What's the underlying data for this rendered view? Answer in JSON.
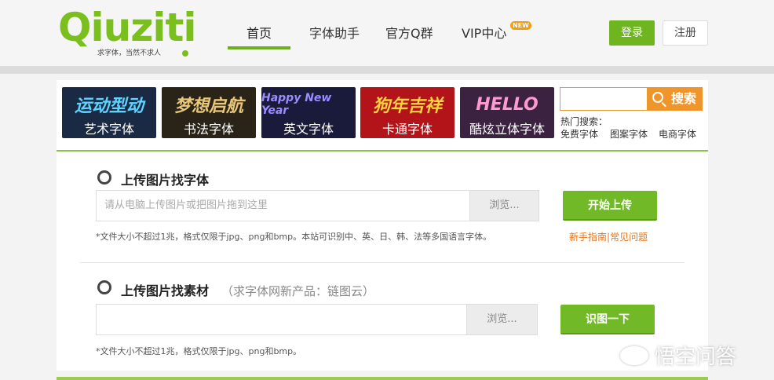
{
  "logo": {
    "word": "Qiuziti",
    "tagline": "求字体，当然不求人"
  },
  "nav": {
    "items": [
      "首页",
      "字体助手",
      "官方Q群",
      "VIP中心"
    ],
    "new_badge": "NEW"
  },
  "auth": {
    "login": "登录",
    "register": "注册"
  },
  "categories": [
    {
      "label": "艺术字体",
      "art": "运动型动",
      "bg": "#1b2a44",
      "color": "#5fd3ff"
    },
    {
      "label": "书法字体",
      "art": "梦想启航",
      "bg": "#2a2418",
      "color": "#e8c77a"
    },
    {
      "label": "英文字体",
      "art": "Happy New Year",
      "bg": "#1a1a3a",
      "color": "#9b8cff"
    },
    {
      "label": "卡通字体",
      "art": "狗年吉祥",
      "bg": "#b3141a",
      "color": "#ffd23f"
    },
    {
      "label": "酷炫立体字体",
      "art": "HELLO",
      "bg": "#3a2240",
      "color": "#ff9ad0"
    }
  ],
  "search": {
    "button": "搜索",
    "placeholder": "",
    "hot_label": "热门搜索：",
    "hot_items": [
      "免费字体",
      "图案字体",
      "电商字体"
    ]
  },
  "upload_font": {
    "title": "上传图片找字体",
    "placeholder": "请从电脑上传图片或把图片拖到这里",
    "browse": "浏览...",
    "button": "开始上传",
    "note": "*文件大小不超过1兆，格式仅限于jpg、png和bmp。本站可识别中、英、日、韩、法等多国语言字体。",
    "help": [
      "新手指南",
      "常见问题"
    ],
    "help_sep": "|"
  },
  "upload_material": {
    "title": "上传图片找素材",
    "subtitle": "（求字体网新产品：链图云）",
    "placeholder": "",
    "browse": "浏览...",
    "button": "识图一下",
    "note": "*文件大小不超过1兆，格式仅限于jpg、png和bmp。"
  },
  "watermark": "悟空问答",
  "colors": {
    "brand_green": "#6eb51f",
    "search_orange": "#f0952a",
    "link_orange": "#e5771f"
  }
}
